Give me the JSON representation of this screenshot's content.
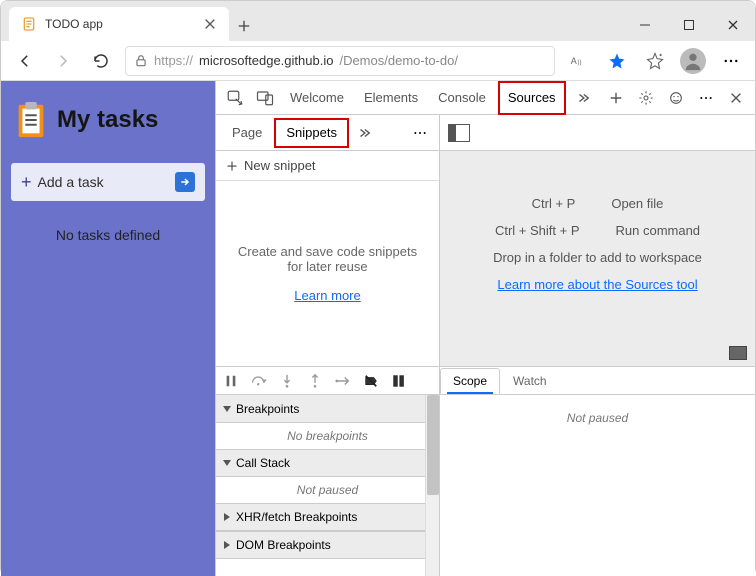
{
  "window": {
    "tab_title": "TODO app"
  },
  "address": {
    "scheme": "https://",
    "host": "microsoftedge.github.io",
    "path": "/Demos/demo-to-do/"
  },
  "page": {
    "title": "My tasks",
    "add_task": "Add a task",
    "no_tasks": "No tasks defined"
  },
  "devtools": {
    "tabs": {
      "welcome": "Welcome",
      "elements": "Elements",
      "console": "Console",
      "sources": "Sources"
    },
    "sources": {
      "nav_tabs": {
        "page": "Page",
        "snippets": "Snippets"
      },
      "new_snippet": "New snippet",
      "help1": "Create and save code snippets for later reuse",
      "learn_more": "Learn more",
      "editor": {
        "shortcut1_key": "Ctrl + P",
        "shortcut1_label": "Open file",
        "shortcut2_key": "Ctrl + Shift + P",
        "shortcut2_label": "Run command",
        "drop_hint": "Drop in a folder to add to workspace",
        "learn_link": "Learn more about the Sources tool"
      },
      "drawer": {
        "breakpoints_title": "Breakpoints",
        "breakpoints_empty": "No breakpoints",
        "callstack_title": "Call Stack",
        "callstack_empty": "Not paused",
        "xhr_title": "XHR/fetch Breakpoints",
        "dom_title": "DOM Breakpoints",
        "scope_tab": "Scope",
        "watch_tab": "Watch",
        "scope_empty": "Not paused"
      }
    }
  }
}
